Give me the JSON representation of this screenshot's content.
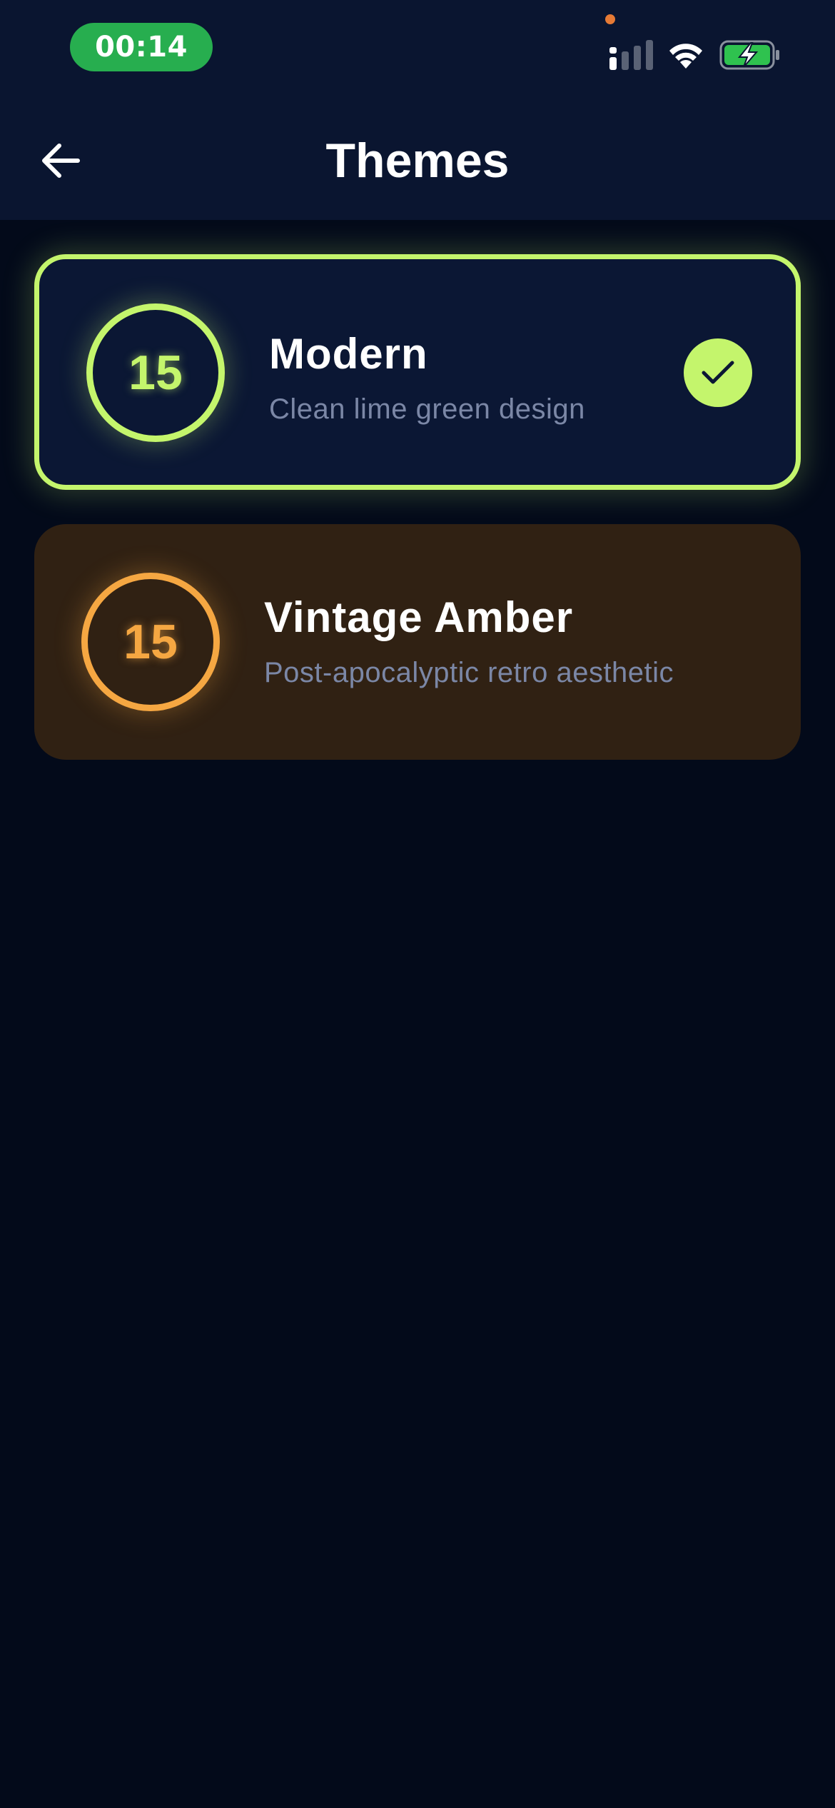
{
  "status_bar": {
    "time": "00:14",
    "icons": [
      "privacy-dot",
      "cellular-signal-icon",
      "wifi-icon",
      "battery-charging-icon"
    ]
  },
  "header": {
    "back_icon": "arrow-left-icon",
    "title": "Themes"
  },
  "themes": [
    {
      "badge": "15",
      "name": "Modern",
      "description": "Clean lime green design",
      "selected": true,
      "accent": "#c4f56c",
      "background": "#0b1734"
    },
    {
      "badge": "15",
      "name": "Vintage Amber",
      "description": "Post-apocalyptic retro aesthetic",
      "selected": false,
      "accent": "#f5a742",
      "background": "#302113"
    }
  ],
  "colors": {
    "app_background": "#030a1a",
    "header_background": "#0a1530",
    "status_time_pill": "#27ae4f",
    "subtitle_text": "#7b87a6"
  }
}
